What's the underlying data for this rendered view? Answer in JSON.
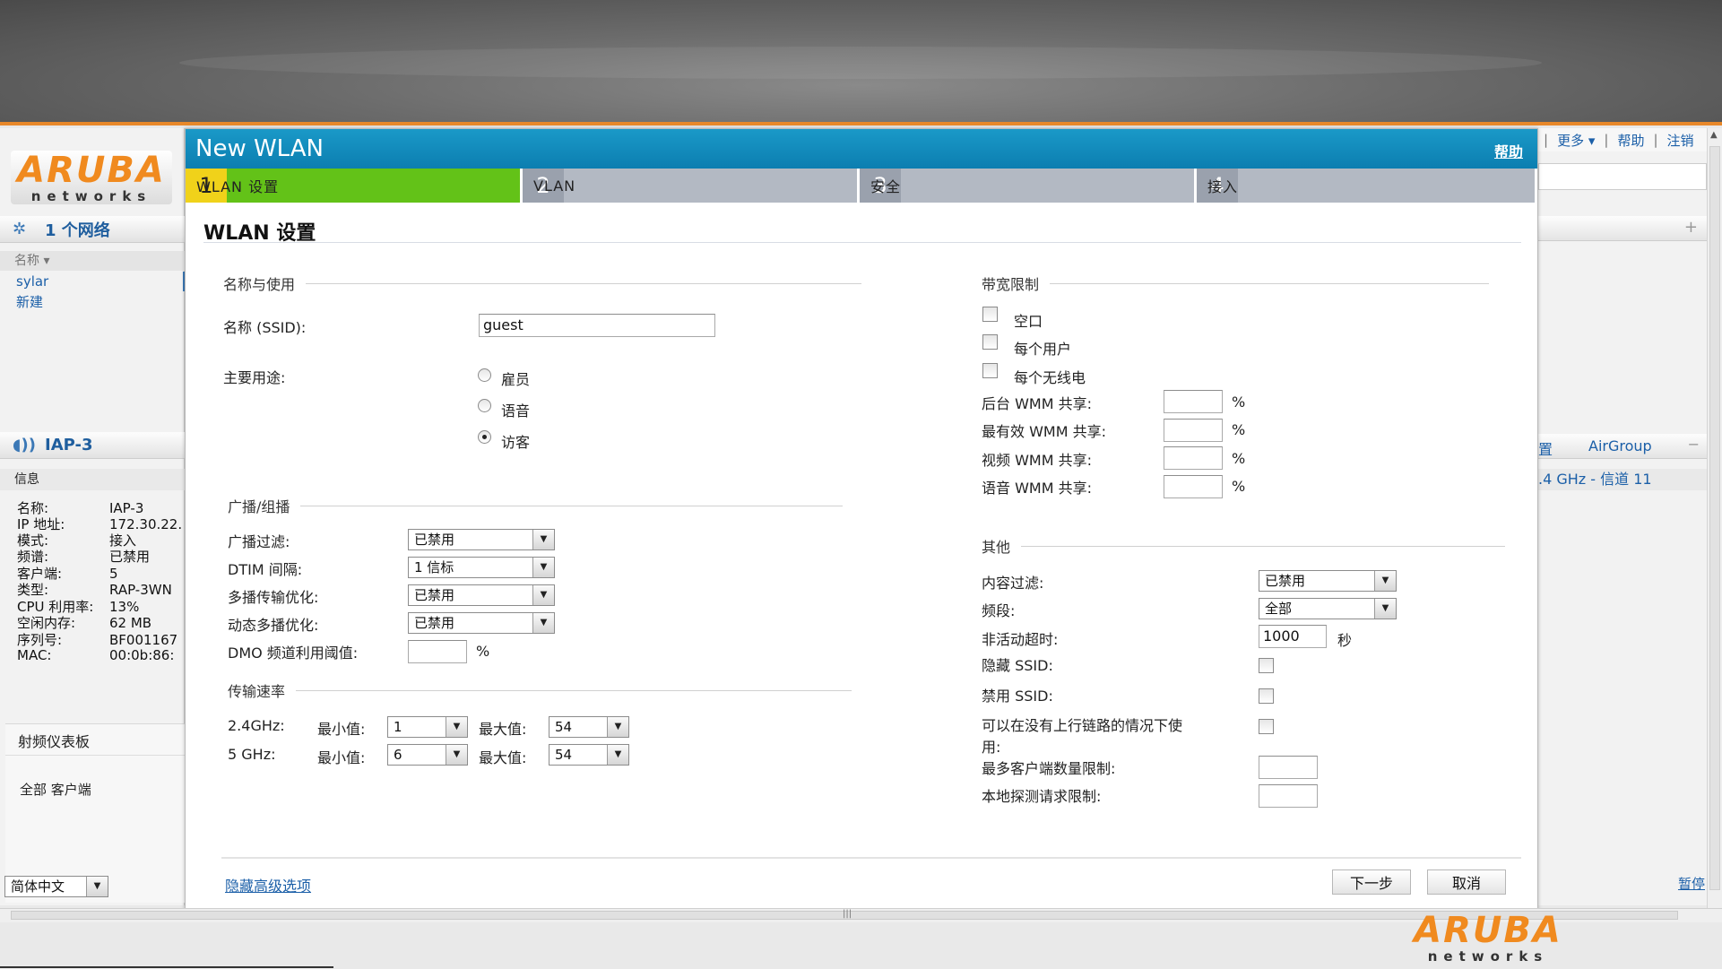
{
  "left": {
    "networks_header": "1 个网络",
    "name_col": "名称",
    "network_items": [
      "sylar",
      "新建"
    ],
    "ap_header": "IAP-3",
    "info_label": "信息",
    "info": [
      {
        "k": "名称:",
        "v": "IAP-3"
      },
      {
        "k": "IP 地址:",
        "v": "172.30.22."
      },
      {
        "k": "模式:",
        "v": "接入"
      },
      {
        "k": "频谱:",
        "v": "已禁用"
      },
      {
        "k": "客户端:",
        "v": "5"
      },
      {
        "k": "类型:",
        "v": "RAP-3WN"
      },
      {
        "k": "CPU 利用率:",
        "v": "13%"
      },
      {
        "k": "空闲内存:",
        "v": "62 MB"
      },
      {
        "k": "序列号:",
        "v": "BF001167"
      },
      {
        "k": "MAC:",
        "v": "00:0b:86:"
      }
    ],
    "rf_dashboard": "射频仪表板",
    "all_clients": "全部 客户端",
    "language": "简体中文"
  },
  "logo": {
    "big": "ARUBA",
    "small": "networks"
  },
  "right": {
    "top_more": "更多",
    "top_help": "帮助",
    "top_logout": "注销",
    "settings_fragment": "置",
    "airgroup": "AirGroup",
    "channel": ".4 GHz - 信道 11",
    "pause": "暂停"
  },
  "dialog": {
    "title": "New WLAN",
    "help": "帮助",
    "steps": [
      {
        "num": "1",
        "label": "WLAN 设置"
      },
      {
        "num": "2",
        "label": "VLAN"
      },
      {
        "num": "3",
        "label": "安全"
      },
      {
        "num": "4",
        "label": "接入"
      }
    ],
    "heading": "WLAN 设置",
    "name_usage": {
      "section": "名称与使用",
      "ssid_label": "名称 (SSID):",
      "ssid_value": "guest",
      "usage_label": "主要用途:",
      "usage_options": [
        "雇员",
        "语音",
        "访客"
      ],
      "usage_selected": "访客"
    },
    "broadcast": {
      "section": "广播/组播",
      "filter_label": "广播过滤:",
      "filter_value": "已禁用",
      "dtim_label": "DTIM 间隔:",
      "dtim_value": "1 信标",
      "mcast_opt_label": "多播传输优化:",
      "mcast_opt_value": "已禁用",
      "dyn_mcast_label": "动态多播优化:",
      "dyn_mcast_value": "已禁用",
      "dmo_label": "DMO 频道利用阈值:",
      "dmo_value": "",
      "pct": "%"
    },
    "rates": {
      "section": "传输速率",
      "band24": "2.4GHz:",
      "band5": "5 GHz:",
      "min_label": "最小值:",
      "max_label": "最大值:",
      "band24_min": "1",
      "band24_max": "54",
      "band5_min": "6",
      "band5_max": "54"
    },
    "bandwidth": {
      "section": "带宽限制",
      "airtime": "空口",
      "per_user": "每个用户",
      "per_radio": "每个无线电",
      "bg_wmm": "后台 WMM 共享:",
      "be_wmm": "最有效 WMM 共享:",
      "video_wmm": "视频 WMM 共享:",
      "voice_wmm": "语音 WMM 共享:",
      "pct": "%"
    },
    "misc": {
      "section": "其他",
      "content_filter_label": "内容过滤:",
      "content_filter_value": "已禁用",
      "band_label": "频段:",
      "band_value": "全部",
      "inactivity_label": "非活动超时:",
      "inactivity_value": "1000",
      "inactivity_unit": "秒",
      "hide_ssid_label": "隐藏 SSID:",
      "disable_ssid_label": "禁用 SSID:",
      "no_uplink_label_1": "可以在没有上行链路的情况下使",
      "no_uplink_label_2": "用:",
      "max_clients_label": "最多客户端数量限制:",
      "probe_limit_label": "本地探测请求限制:"
    },
    "advanced_link": "隐藏高级选项",
    "next": "下一步",
    "cancel": "取消"
  }
}
